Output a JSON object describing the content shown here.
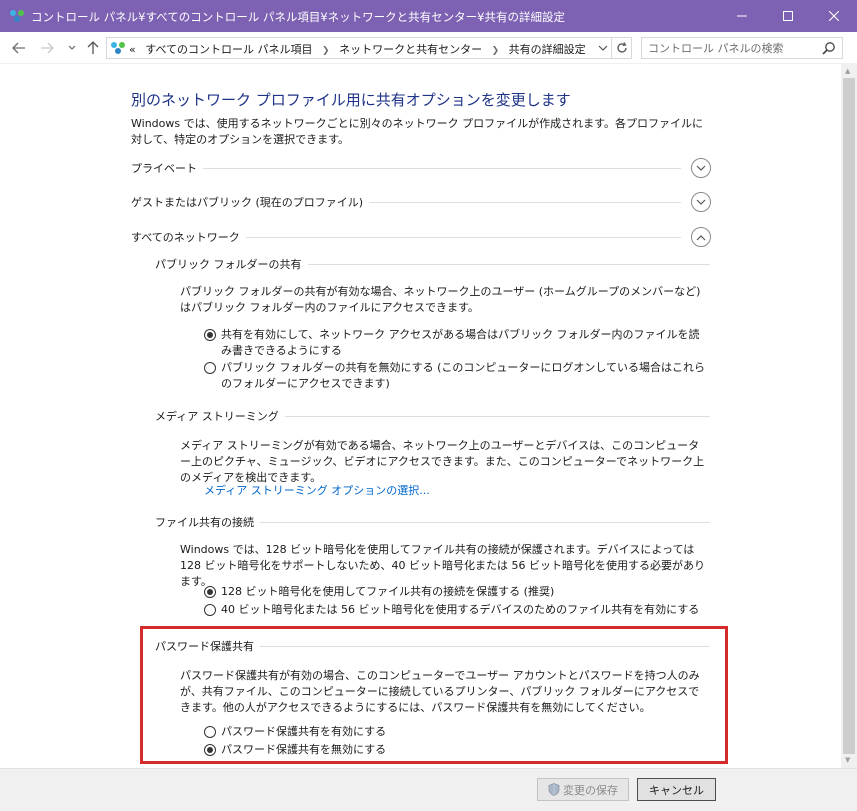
{
  "window": {
    "title": "コントロール パネル¥すべてのコントロール パネル項目¥ネットワークと共有センター¥共有の詳細設定"
  },
  "address_bar": {
    "overflow": "«",
    "crumbs": [
      "すべてのコントロール パネル項目",
      "ネットワークと共有センター",
      "共有の詳細設定"
    ]
  },
  "search": {
    "placeholder": "コントロール パネルの検索"
  },
  "page": {
    "heading": "別のネットワーク プロファイル用に共有オプションを変更します",
    "intro": "Windows では、使用するネットワークごとに別々のネットワーク プロファイルが作成されます。各プロファイルに対して、特定のオプションを選択できます。"
  },
  "profiles": [
    {
      "label": "プライベート",
      "expanded": false
    },
    {
      "label": "ゲストまたはパブリック (現在のプロファイル)",
      "expanded": false
    },
    {
      "label": "すべてのネットワーク",
      "expanded": true
    }
  ],
  "public_folder": {
    "title": "パブリック フォルダーの共有",
    "desc": "パブリック フォルダーの共有が有効な場合、ネットワーク上のユーザー (ホームグループのメンバーなど) はパブリック フォルダー内のファイルにアクセスできます。",
    "options": [
      {
        "label": "共有を有効にして、ネットワーク アクセスがある場合はパブリック フォルダー内のファイルを読み書きできるようにする",
        "selected": true
      },
      {
        "label": "パブリック フォルダーの共有を無効にする (このコンピューターにログオンしている場合はこれらのフォルダーにアクセスできます)",
        "selected": false
      }
    ]
  },
  "media_streaming": {
    "title": "メディア ストリーミング",
    "desc": "メディア ストリーミングが有効である場合、ネットワーク上のユーザーとデバイスは、このコンピューター上のピクチャ、ミュージック、ビデオにアクセスできます。また、このコンピューターでネットワーク上のメディアを検出できます。",
    "link": "メディア ストリーミング オプションの選択..."
  },
  "file_sharing": {
    "title": "ファイル共有の接続",
    "desc": "Windows では、128 ビット暗号化を使用してファイル共有の接続が保護されます。デバイスによっては 128 ビット暗号化をサポートしないため、40 ビット暗号化または 56 ビット暗号化を使用する必要があります。",
    "options": [
      {
        "label": "128 ビット暗号化を使用してファイル共有の接続を保護する (推奨)",
        "selected": true
      },
      {
        "label": "40 ビット暗号化または 56 ビット暗号化を使用するデバイスのためのファイル共有を有効にする",
        "selected": false
      }
    ]
  },
  "password_sharing": {
    "title": "パスワード保護共有",
    "desc": "パスワード保護共有が有効の場合、このコンピューターでユーザー アカウントとパスワードを持つ人のみが、共有ファイル、このコンピューターに接続しているプリンター、パブリック フォルダーにアクセスできます。他の人がアクセスできるようにするには、パスワード保護共有を無効にしてください。",
    "options": [
      {
        "label": "パスワード保護共有を有効にする",
        "selected": false
      },
      {
        "label": "パスワード保護共有を無効にする",
        "selected": true
      }
    ]
  },
  "highlight_color": "#d52b2b",
  "titlebar_color": "#7d62b3",
  "footer": {
    "save_label": "変更の保存",
    "cancel_label": "キャンセル"
  }
}
